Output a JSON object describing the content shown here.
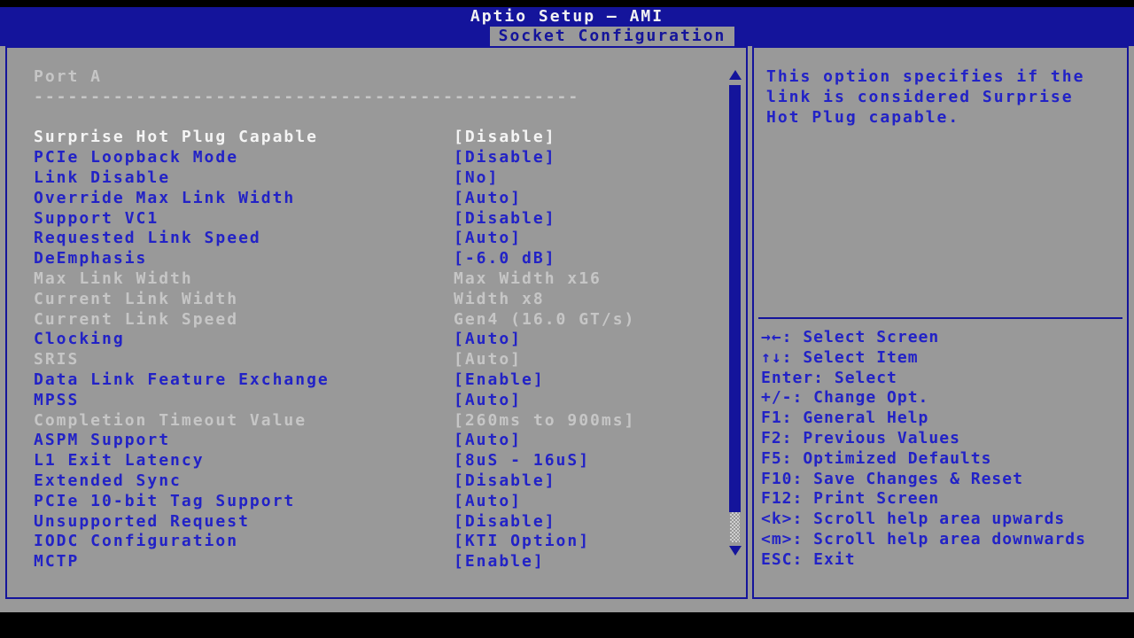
{
  "header": {
    "title": "Aptio Setup – AMI",
    "tab": "Socket Configuration"
  },
  "menu": {
    "section_title": "Port A",
    "separator": "------------------------------------------------",
    "items": [
      {
        "label": "Surprise Hot Plug Capable",
        "value": "[Disable]",
        "state": "selected"
      },
      {
        "label": "PCIe Loopback Mode",
        "value": "[Disable]",
        "state": "normal"
      },
      {
        "label": "Link Disable",
        "value": "[No]",
        "state": "normal"
      },
      {
        "label": "Override Max Link Width",
        "value": "[Auto]",
        "state": "normal"
      },
      {
        "label": "Support VC1",
        "value": "[Disable]",
        "state": "normal"
      },
      {
        "label": "Requested Link Speed",
        "value": "[Auto]",
        "state": "normal"
      },
      {
        "label": "DeEmphasis",
        "value": "[-6.0 dB]",
        "state": "normal"
      },
      {
        "label": "Max Link Width",
        "value": "Max Width x16",
        "state": "readonly"
      },
      {
        "label": "Current Link Width",
        "value": "Width x8",
        "state": "readonly"
      },
      {
        "label": "Current Link Speed",
        "value": "Gen4 (16.0 GT/s)",
        "state": "readonly"
      },
      {
        "label": "Clocking",
        "value": "[Auto]",
        "state": "normal"
      },
      {
        "label": "SRIS",
        "value": "[Auto]",
        "state": "readonly"
      },
      {
        "label": "Data Link Feature Exchange",
        "value": "[Enable]",
        "state": "normal"
      },
      {
        "label": "MPSS",
        "value": "[Auto]",
        "state": "normal"
      },
      {
        "label": "Completion Timeout Value",
        "value": "[260ms to 900ms]",
        "state": "readonly"
      },
      {
        "label": "ASPM Support",
        "value": "[Auto]",
        "state": "normal"
      },
      {
        "label": "L1 Exit Latency",
        "value": "[8uS - 16uS]",
        "state": "normal"
      },
      {
        "label": "Extended Sync",
        "value": "[Disable]",
        "state": "normal"
      },
      {
        "label": "PCIe 10-bit Tag Support",
        "value": "[Auto]",
        "state": "normal"
      },
      {
        "label": "Unsupported Request",
        "value": "[Disable]",
        "state": "normal"
      },
      {
        "label": "IODC Configuration",
        "value": "[KTI Option]",
        "state": "normal"
      },
      {
        "label": "MCTP",
        "value": "[Enable]",
        "state": "normal"
      }
    ]
  },
  "help": {
    "lines": [
      "This option specifies if the",
      "link is considered Surprise",
      "Hot Plug capable."
    ]
  },
  "key_legend": [
    "→←: Select Screen",
    "↑↓: Select Item",
    "Enter: Select",
    "+/-: Change Opt.",
    "F1: General Help",
    "F2: Previous Values",
    "F5: Optimized Defaults",
    "F10: Save Changes & Reset",
    "F12: Print Screen",
    "<k>: Scroll help area upwards",
    "<m>: Scroll help area downwards",
    "ESC: Exit"
  ],
  "colors": {
    "band_blue": "#14149b",
    "item_blue": "#2222c6",
    "background_gray": "#999999",
    "selected_white": "#f4f4f4",
    "readonly_gray": "#c6c6c6",
    "outer_black": "#000000"
  }
}
